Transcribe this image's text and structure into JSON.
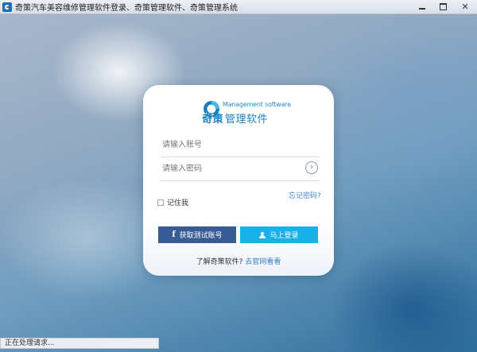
{
  "window": {
    "title": "奇策汽车美容维修管理软件登录、奇策管理软件、奇策管理系统",
    "controls": {
      "minimize": "",
      "maximize": "",
      "close": "✕"
    }
  },
  "brand": {
    "name_en": "Management software",
    "name_cn_prefix": "奇策",
    "name_cn_suffix": "管理软件",
    "icon": "brand-swirl-icon"
  },
  "login": {
    "username_placeholder": "请输入账号",
    "password_placeholder": "请输入密码",
    "username_value": "",
    "password_value": "",
    "go_icon": "chevron-right-icon",
    "forgot_password": "忘记密码?",
    "remember_me": "记住我",
    "remember_checked": false,
    "test_account_button": "获取测试账号",
    "login_button": "马上登录",
    "learn_more_text": "了解奇策软件?",
    "learn_more_link": "去官网看看"
  },
  "status": {
    "text": "正在处理请求..."
  },
  "colors": {
    "test_button_bg": "#375b94",
    "login_button_bg": "#1ab0ea",
    "brand_blue": "#1a7fc1",
    "link_blue": "#3a8ad0"
  }
}
